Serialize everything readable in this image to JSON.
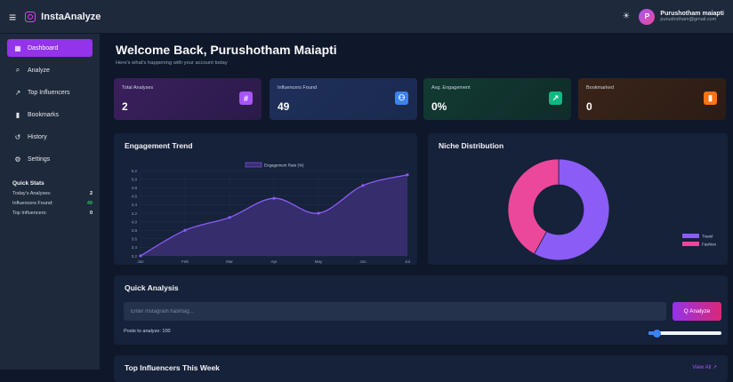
{
  "header": {
    "brand": "InstaAnalyze",
    "user_initial": "P",
    "user_name": "Purushotham maiapti",
    "user_email": "purushotham@gmail.com"
  },
  "sidebar": {
    "items": [
      {
        "label": "Dashboard",
        "icon": "dashboard-icon",
        "active": true
      },
      {
        "label": "Analyze",
        "icon": "search-icon",
        "active": false
      },
      {
        "label": "Top Influencers",
        "icon": "chart-icon",
        "active": false
      },
      {
        "label": "Bookmarks",
        "icon": "bookmark-icon",
        "active": false
      },
      {
        "label": "History",
        "icon": "history-icon",
        "active": false
      },
      {
        "label": "Settings",
        "icon": "gear-icon",
        "active": false
      }
    ],
    "quick_stats": {
      "title": "Quick Stats",
      "rows": [
        {
          "label": "Today's Analyses:",
          "value": "2"
        },
        {
          "label": "Influencers Found:",
          "value": "49"
        },
        {
          "label": "Top Influencers:",
          "value": "0"
        }
      ]
    }
  },
  "main": {
    "welcome": "Welcome Back, Purushotham Maiapti",
    "subtitle": "Here's what's happening with your account today",
    "cards": [
      {
        "label": "Total Analyses",
        "value": "2",
        "icon": "hash-icon"
      },
      {
        "label": "Influencers Found",
        "value": "49",
        "icon": "users-icon"
      },
      {
        "label": "Avg. Engagement",
        "value": "0%",
        "icon": "trend-icon"
      },
      {
        "label": "Bookmarked",
        "value": "0",
        "icon": "bookmark-icon"
      }
    ],
    "quick_analysis": {
      "title": "Quick Analysis",
      "placeholder": "Enter Instagram hashtag...",
      "button": "Q Analyze",
      "posts_label": "Posts to analyze: 100",
      "slider_fraction": 0.1
    },
    "top_influencers": {
      "title": "Top Influencers This Week",
      "view_all": "View All ↗"
    }
  },
  "chart_data": [
    {
      "type": "line",
      "title": "Engagement Trend",
      "categories": [
        "Jan",
        "Feb",
        "Mar",
        "Apr",
        "May",
        "Jun",
        "Jul"
      ],
      "series": [
        {
          "name": "Engagement Rate (%)",
          "values": [
            3.2,
            3.8,
            4.1,
            4.55,
            4.2,
            4.85,
            5.1
          ]
        }
      ],
      "yticks": [
        "5.2",
        "5.0",
        "4.8",
        "4.6",
        "4.4",
        "4.2",
        "4.0",
        "3.8",
        "3.6",
        "3.4",
        "3.2"
      ],
      "ylim": [
        3.2,
        5.2
      ],
      "colors": {
        "line": "#8b5cf6",
        "fill": "#3b2f75"
      },
      "legend": "top"
    },
    {
      "type": "pie",
      "title": "Niche Distribution",
      "labels": [
        "Travel",
        "Fashion"
      ],
      "values": [
        58,
        42
      ],
      "colors": [
        "#8b5cf6",
        "#ec4899"
      ],
      "legend": "right"
    }
  ]
}
